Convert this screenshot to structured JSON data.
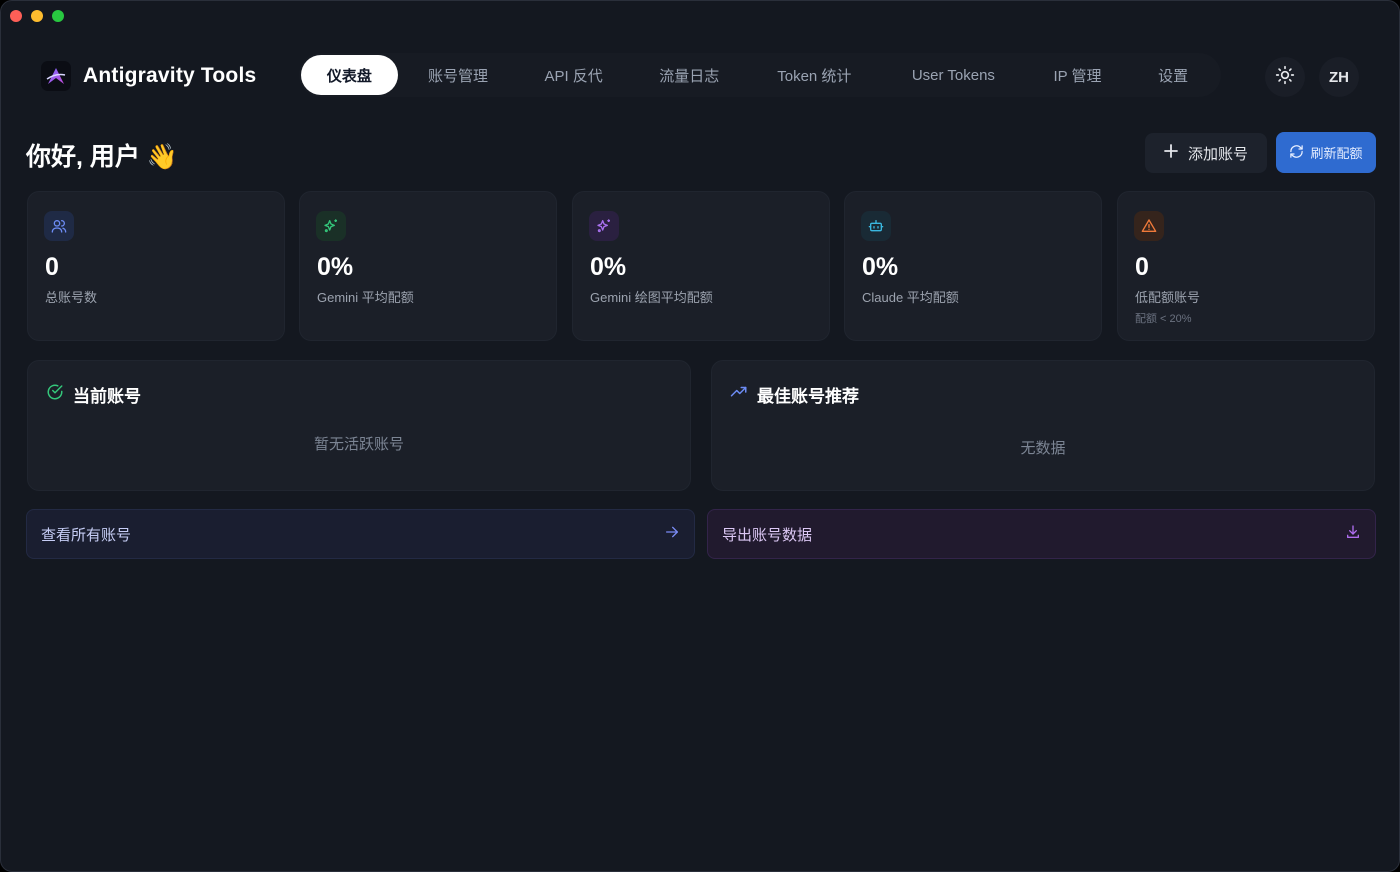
{
  "app": {
    "name": "Antigravity Tools"
  },
  "nav": {
    "items": [
      {
        "label": "仪表盘",
        "active": true
      },
      {
        "label": "账号管理",
        "active": false
      },
      {
        "label": "API 反代",
        "active": false
      },
      {
        "label": "流量日志",
        "active": false
      },
      {
        "label": "Token 统计",
        "active": false
      },
      {
        "label": "User Tokens",
        "active": false
      },
      {
        "label": "IP 管理",
        "active": false
      },
      {
        "label": "设置",
        "active": false
      }
    ]
  },
  "header": {
    "theme_icon": "sun-icon",
    "language": "ZH"
  },
  "page": {
    "greeting": "你好, 用户 👋",
    "add_account_label": "添加账号",
    "refresh_quota_label": "刷新配额"
  },
  "stats": [
    {
      "value": "0",
      "label": "总账号数",
      "sub": "",
      "icon": "users-icon",
      "color": "#6d8cf5"
    },
    {
      "value": "0%",
      "label": "Gemini 平均配额",
      "sub": "",
      "icon": "sparkles-icon",
      "color": "#34c77b"
    },
    {
      "value": "0%",
      "label": "Gemini 绘图平均配额",
      "sub": "",
      "icon": "sparkles-icon",
      "color": "#a971f0"
    },
    {
      "value": "0%",
      "label": "Claude 平均配额",
      "sub": "",
      "icon": "bot-icon",
      "color": "#3ab8e0"
    },
    {
      "value": "0",
      "label": "低配额账号",
      "sub": "配额 < 20%",
      "icon": "warning-icon",
      "color": "#f07a3a"
    }
  ],
  "current_account": {
    "title": "当前账号",
    "empty_text": "暂无活跃账号"
  },
  "best_account": {
    "title": "最佳账号推荐",
    "empty_text": "无数据"
  },
  "actions": {
    "view_all_label": "查看所有账号",
    "export_label": "导出账号数据"
  },
  "colors": {
    "primary": "#2f6bd0",
    "background": "#141820",
    "card": "#1b1f28",
    "success": "#34c77b"
  }
}
